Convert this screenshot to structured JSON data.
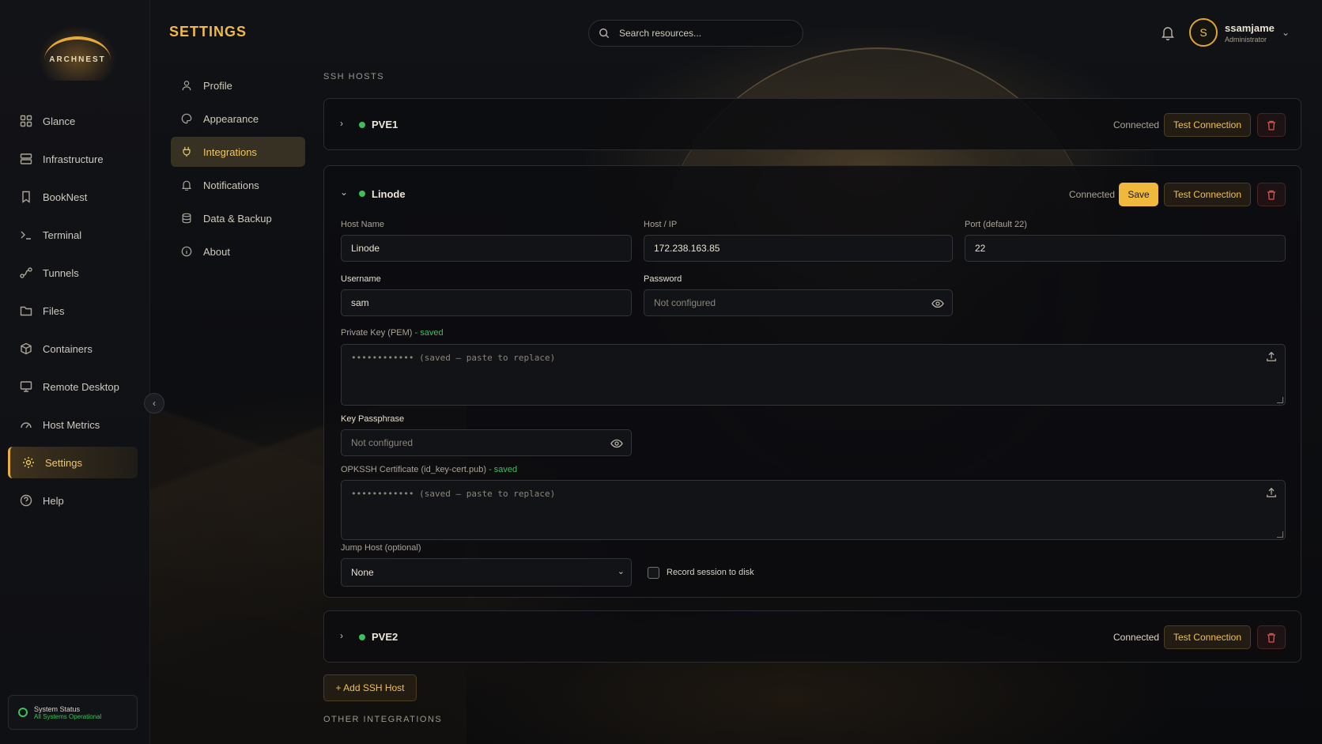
{
  "app": {
    "logo_text": "ARCHNEST",
    "page_title": "SETTINGS"
  },
  "sidebar": {
    "items": [
      {
        "label": "Glance",
        "icon": "grid-icon"
      },
      {
        "label": "Infrastructure",
        "icon": "server-icon"
      },
      {
        "label": "BookNest",
        "icon": "bookmark-icon"
      },
      {
        "label": "Terminal",
        "icon": "terminal-icon"
      },
      {
        "label": "Tunnels",
        "icon": "tunnel-icon"
      },
      {
        "label": "Files",
        "icon": "folder-icon"
      },
      {
        "label": "Containers",
        "icon": "box-icon"
      },
      {
        "label": "Remote Desktop",
        "icon": "monitor-icon"
      },
      {
        "label": "Host Metrics",
        "icon": "gauge-icon"
      },
      {
        "label": "Settings",
        "icon": "gear-icon",
        "active": true
      },
      {
        "label": "Help",
        "icon": "help-icon"
      }
    ],
    "status_title": "System Status",
    "status_sub": "All Systems Operational"
  },
  "header": {
    "search_placeholder": "Search resources...",
    "user_initial": "S",
    "user_name": "ssamjame",
    "user_role": "Administrator"
  },
  "subnav": {
    "items": [
      {
        "label": "Profile",
        "icon": "user-icon"
      },
      {
        "label": "Appearance",
        "icon": "palette-icon"
      },
      {
        "label": "Integrations",
        "icon": "plug-icon",
        "active": true
      },
      {
        "label": "Notifications",
        "icon": "bell-icon"
      },
      {
        "label": "Data & Backup",
        "icon": "database-icon"
      },
      {
        "label": "About",
        "icon": "info-icon"
      }
    ]
  },
  "main": {
    "ssh_hosts_label": "SSH HOSTS",
    "other_label": "OTHER INTEGRATIONS",
    "add_host": "+ Add SSH Host",
    "hosts": [
      {
        "name": "PVE1",
        "status": "Connected",
        "test": "Test Connection",
        "expanded": false
      },
      {
        "name": "Linode",
        "status": "Connected",
        "save": "Save",
        "test": "Test Connection",
        "expanded": true,
        "labels": {
          "host_name": "Host Name",
          "host_ip": "Host / IP",
          "port": "Port (default 22)",
          "username": "Username",
          "password": "Password",
          "private_key": "Private Key (PEM)",
          "key_passphrase": "Key Passphrase",
          "opkssh": "OPKSSH Certificate (id_key-cert.pub)",
          "saved_suffix": " - saved",
          "jump_host": "Jump Host (optional)",
          "record": "Record session to disk"
        },
        "values": {
          "host_name": "Linode",
          "host_ip": "172.238.163.85",
          "port": "22",
          "username": "sam",
          "password_placeholder": "Not configured",
          "private_key_placeholder": "•••••••••••• (saved — paste to replace)",
          "passphrase_placeholder": "Not configured",
          "opkssh_placeholder": "•••••••••••• (saved — paste to replace)",
          "jump_host": "None",
          "record_checked": false
        }
      },
      {
        "name": "PVE2",
        "status": "Connected",
        "test": "Test Connection",
        "expanded": false
      }
    ]
  },
  "colors": {
    "accent": "#f0b93c",
    "connected": "#3dbf5a",
    "danger": "#e0524a"
  }
}
